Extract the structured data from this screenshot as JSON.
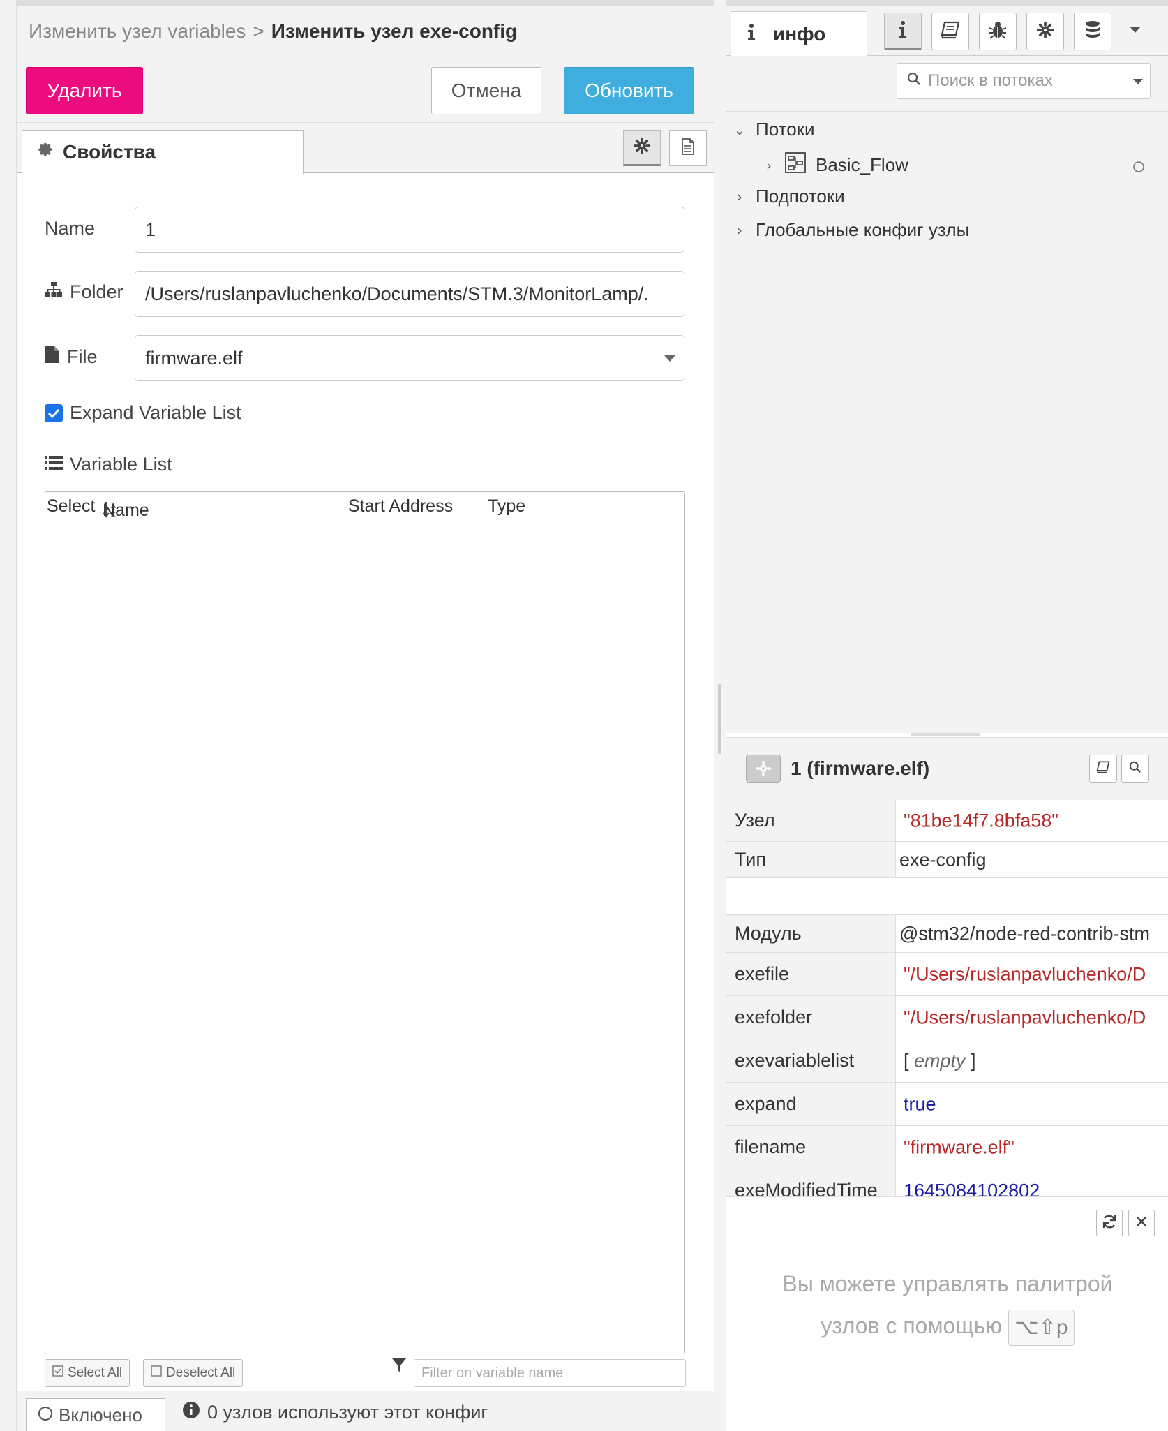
{
  "tray": {
    "breadcrumb_prev": "Изменить узел variables",
    "breadcrumb_sep": ">",
    "breadcrumb_current": "Изменить узел exe-config",
    "delete_label": "Удалить",
    "cancel_label": "Отмена",
    "update_label": "Обновить",
    "tab_properties": "Свойства",
    "name_label": "Name",
    "name_value": "1",
    "folder_label": "Folder",
    "folder_value": "/Users/ruslanpavluchenko/Documents/STM.3/MonitorLamp/.",
    "file_label": "File",
    "file_value": "firmware.elf",
    "expand_label": "Expand Variable List",
    "expand_checked": true,
    "varlist_label": "Variable List",
    "columns": [
      "Select",
      "Name",
      "Start Address",
      "Type"
    ],
    "select_all": "Select All",
    "deselect_all": "Deselect All",
    "filter_placeholder": "Filter on variable name",
    "enabled_label": "Включено",
    "usage_info": "0 узлов используют этот конфиг"
  },
  "sidebar": {
    "tab_info": "инфо",
    "search_placeholder": "Поиск в потоках",
    "tree": {
      "flows": "Потоки",
      "flow_item": "Basic_Flow",
      "subflows": "Подпотоки",
      "global_config": "Глобальные конфиг узлы"
    },
    "node_title": "1 (firmware.elf)",
    "properties": [
      {
        "key": "Узел",
        "value": "\"81be14f7.8bfa58\"",
        "kind": "str"
      },
      {
        "key": "Тип",
        "value": "exe-config",
        "kind": "plain"
      },
      {
        "key": "Модуль",
        "value": "@stm32/node-red-contrib-stm",
        "kind": "plain"
      },
      {
        "key": "exefile",
        "value": "\"/Users/ruslanpavluchenko/D",
        "kind": "str"
      },
      {
        "key": "exefolder",
        "value": "\"/Users/ruslanpavluchenko/D",
        "kind": "str"
      },
      {
        "key": "exevariablelist",
        "value_prefix": "[ ",
        "value_italic": "empty",
        "value_suffix": " ]",
        "kind": "empty"
      },
      {
        "key": "expand",
        "value": "true",
        "kind": "bool"
      },
      {
        "key": "filename",
        "value": "\"firmware.elf\"",
        "kind": "str"
      },
      {
        "key": "exeModifiedTime",
        "value": "1645084102802",
        "kind": "num"
      }
    ],
    "help_line1": "Вы можете управлять палитрой",
    "help_line2": "узлов с помощью",
    "help_shortcut": "⌥⇧p"
  },
  "colors": {
    "delete": "#ed0c7f",
    "update": "#3fadde",
    "string_value": "#b72828",
    "bool_value": "#1a1aa6"
  }
}
